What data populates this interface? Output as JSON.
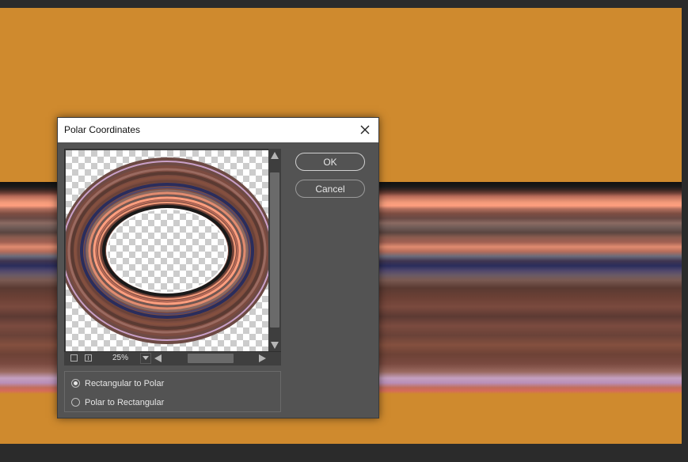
{
  "dialog": {
    "title": "Polar Coordinates",
    "ok_label": "OK",
    "cancel_label": "Cancel",
    "zoom": "25%",
    "options": [
      {
        "label": "Rectangular to Polar",
        "checked": true
      },
      {
        "label": "Polar to Rectangular",
        "checked": false
      }
    ]
  },
  "icons": {
    "close": "close-icon",
    "zoom_out": "zoom-out-icon",
    "zoom_in": "zoom-in-icon",
    "dropdown": "chevron-down-icon",
    "scroll_up": "arrow-up-icon",
    "scroll_down": "arrow-down-icon",
    "scroll_left": "arrow-left-icon",
    "scroll_right": "arrow-right-icon"
  },
  "colors": {
    "canvas_background": "#cf8a2e",
    "dialog_background": "#535353",
    "titlebar_background": "#ffffff"
  }
}
